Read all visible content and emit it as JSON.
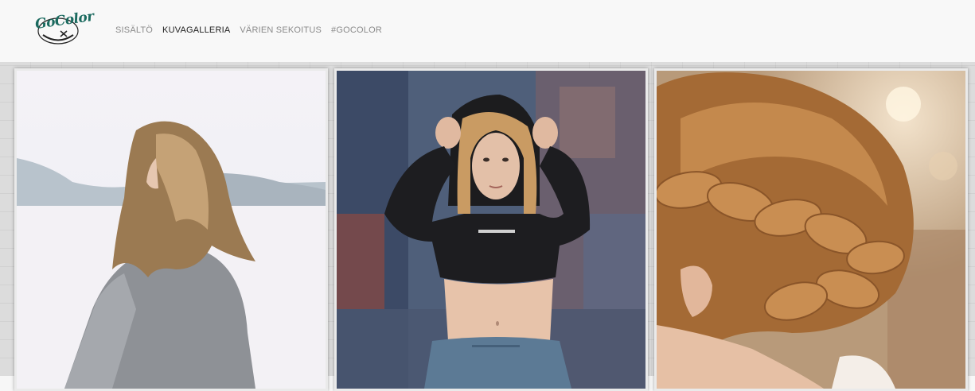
{
  "logo": {
    "text": "GoColor",
    "icon": "gocolor-logo-icon"
  },
  "nav": {
    "items": [
      {
        "label": "SISÄLTÖ",
        "active": false
      },
      {
        "label": "KUVAGALLERIA",
        "active": true
      },
      {
        "label": "VÄRIEN SEKOITUS",
        "active": false
      },
      {
        "label": "#GOCOLOR",
        "active": false
      }
    ]
  },
  "gallery": {
    "images": [
      {
        "subject": "woman-in-snow-photo"
      },
      {
        "subject": "woman-in-black-hoodie-photo"
      },
      {
        "subject": "braided-hair-photo"
      }
    ]
  },
  "colors": {
    "brand": "#1b6a5f",
    "nav_text": "#8a8a8a",
    "nav_active": "#222222"
  }
}
